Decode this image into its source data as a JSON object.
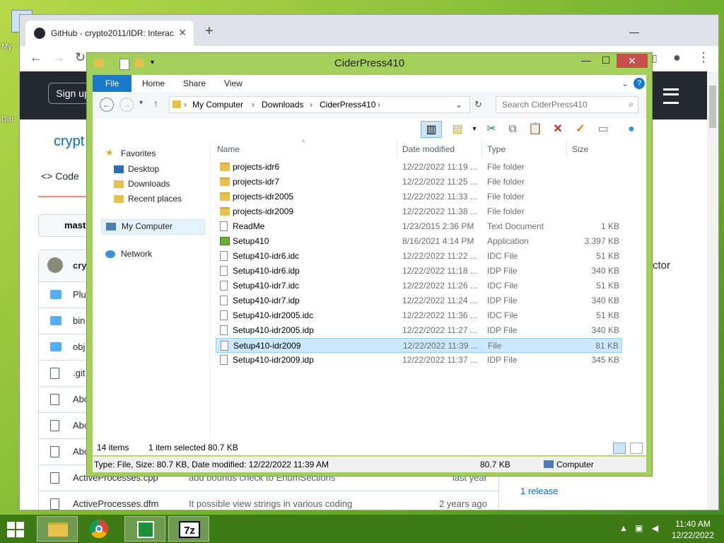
{
  "desktop": {
    "icon_labels": [
      "My",
      "Dat"
    ]
  },
  "browser": {
    "tab_title": "GitHub - crypto2011/IDR: Interac",
    "tab_close": "✕",
    "new_tab": "+",
    "signup": "Sign up",
    "repo_title": "crypt",
    "code_tab": "Code",
    "branch": "mast",
    "partial_right": "ctor",
    "release_text": "1 release",
    "files": [
      {
        "name": "Plu",
        "kind": "folder",
        "msg": "",
        "age": ""
      },
      {
        "name": "bin",
        "kind": "folder",
        "msg": "",
        "age": ""
      },
      {
        "name": "obj",
        "kind": "folder",
        "msg": "",
        "age": ""
      },
      {
        "name": ".git",
        "kind": "file",
        "msg": "",
        "age": ""
      },
      {
        "name": "Abo",
        "kind": "file",
        "msg": "",
        "age": ""
      },
      {
        "name": "Abo",
        "kind": "file",
        "msg": "",
        "age": ""
      },
      {
        "name": "Abo",
        "kind": "file",
        "msg": "",
        "age": ""
      },
      {
        "name": "ActiveProcesses.cpp",
        "kind": "file",
        "msg": "add bounds check to EnumSections",
        "age": "last year"
      },
      {
        "name": "ActiveProcesses.dfm",
        "kind": "file",
        "msg": "It possible view strings in various coding",
        "age": "2 years ago"
      }
    ]
  },
  "explorer": {
    "title": "CiderPress410",
    "ribbon_tabs": [
      "File",
      "Home",
      "Share",
      "View"
    ],
    "breadcrumbs": [
      "My Computer",
      "Downloads",
      "CiderPress410"
    ],
    "search_placeholder": "Search CiderPress410",
    "nav": {
      "favorites": "Favorites",
      "desktop": "Desktop",
      "downloads": "Downloads",
      "recent": "Recent places",
      "my_computer": "My Computer",
      "network": "Network"
    },
    "columns": {
      "name": "Name",
      "date": "Date modified",
      "type": "Type",
      "size": "Size"
    },
    "files": [
      {
        "name": "projects-idr6",
        "date": "12/22/2022 11:19 ...",
        "type": "File folder",
        "size": "",
        "icon": "folder"
      },
      {
        "name": "projects-idr7",
        "date": "12/22/2022 11:25 ...",
        "type": "File folder",
        "size": "",
        "icon": "folder"
      },
      {
        "name": "projects-idr2005",
        "date": "12/22/2022 11:33 ...",
        "type": "File folder",
        "size": "",
        "icon": "folder"
      },
      {
        "name": "projects-idr2009",
        "date": "12/22/2022 11:38 ...",
        "type": "File folder",
        "size": "",
        "icon": "folder"
      },
      {
        "name": "ReadMe",
        "date": "1/23/2015 2:36 PM",
        "type": "Text Document",
        "size": "1 KB",
        "icon": "file"
      },
      {
        "name": "Setup410",
        "date": "8/16/2021 4:14 PM",
        "type": "Application",
        "size": "3,397 KB",
        "icon": "app"
      },
      {
        "name": "Setup410-idr6.idc",
        "date": "12/22/2022 11:22 ...",
        "type": "IDC File",
        "size": "51 KB",
        "icon": "file"
      },
      {
        "name": "Setup410-idr6.idp",
        "date": "12/22/2022 11:18 ...",
        "type": "IDP File",
        "size": "340 KB",
        "icon": "file"
      },
      {
        "name": "Setup410-idr7.idc",
        "date": "12/22/2022 11:26 ...",
        "type": "IDC File",
        "size": "51 KB",
        "icon": "file"
      },
      {
        "name": "Setup410-idr7.idp",
        "date": "12/22/2022 11:24 ...",
        "type": "IDP File",
        "size": "340 KB",
        "icon": "file"
      },
      {
        "name": "Setup410-idr2005.idc",
        "date": "12/22/2022 11:36 ...",
        "type": "IDC File",
        "size": "51 KB",
        "icon": "file"
      },
      {
        "name": "Setup410-idr2005.idp",
        "date": "12/22/2022 11:27 ...",
        "type": "IDP File",
        "size": "340 KB",
        "icon": "file"
      },
      {
        "name": "Setup410-idr2009",
        "date": "12/22/2022 11:39 ...",
        "type": "File",
        "size": "81 KB",
        "icon": "file",
        "selected": true
      },
      {
        "name": "Setup410-idr2009.idp",
        "date": "12/22/2022 11:37 ...",
        "type": "IDP File",
        "size": "345 KB",
        "icon": "file"
      }
    ],
    "status_items": "14 items",
    "status_selected": "1 item selected  80.7 KB",
    "details_text": "Type: File, Size: 80.7 KB, Date modified: 12/22/2022 11:39 AM",
    "details_size": "80.7 KB",
    "details_location": "Computer"
  },
  "taskbar": {
    "apps": [
      "file-explorer",
      "chrome",
      "store",
      "7zip"
    ],
    "sevenzip_label": "7z",
    "time": "11:40 AM",
    "date": "12/22/2022"
  }
}
